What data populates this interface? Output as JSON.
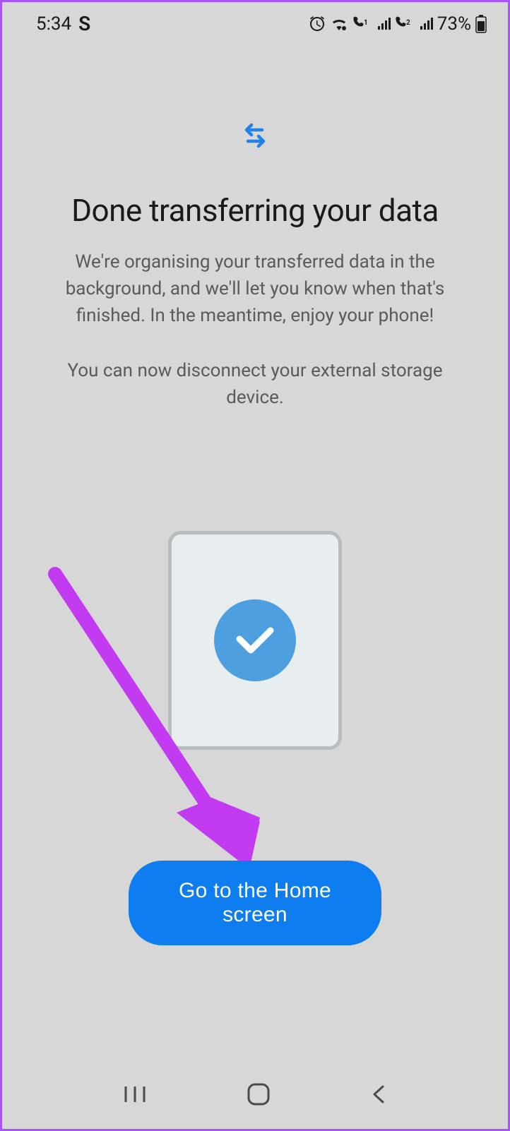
{
  "status": {
    "time": "5:34",
    "app_indicator": "S",
    "battery": "73%"
  },
  "main": {
    "title": "Done transferring your data",
    "description1": "We're organising your transferred data in the background, and we'll let you know when that's finished. In the meantime, enjoy your phone!",
    "description2": "You can now disconnect your external storage device."
  },
  "button": {
    "home_label": "Go to the Home screen"
  }
}
